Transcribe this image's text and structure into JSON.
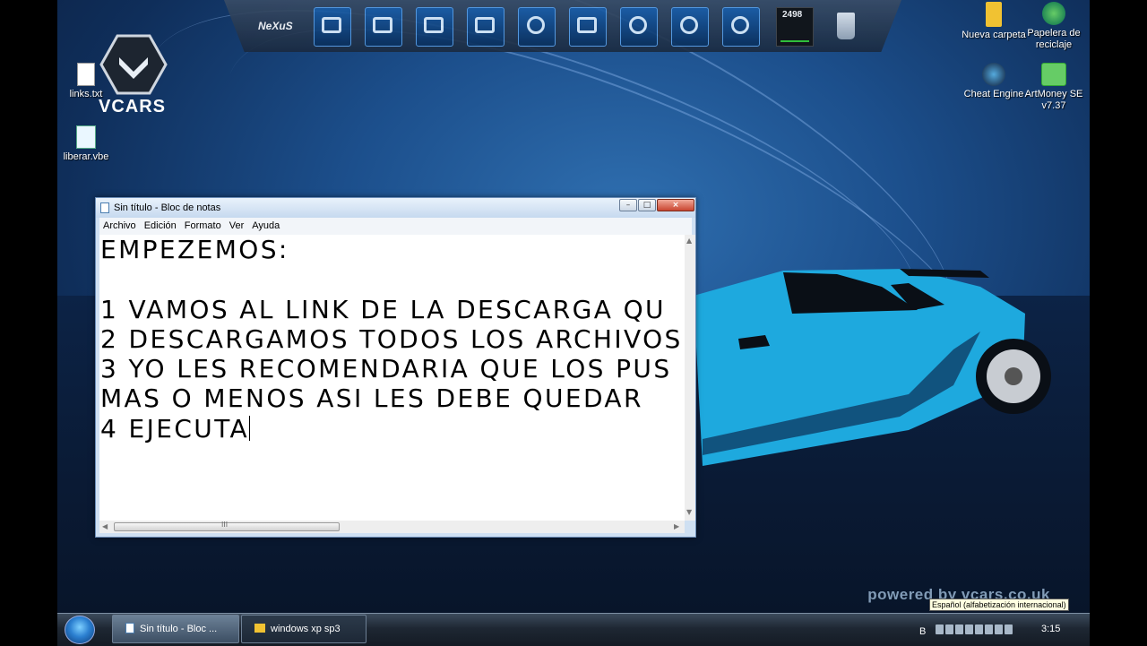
{
  "desktop": {
    "logo_text": "VCARS",
    "watermark": "powered by vcars.co.uk",
    "icons_left": [
      {
        "label": "links.txt",
        "icon": "text-file-icon"
      },
      {
        "label": "liberar.vbe",
        "icon": "script-file-icon"
      }
    ],
    "icons_right": [
      {
        "label": "Nueva carpeta",
        "icon": "folder-icon"
      },
      {
        "label": "Papelera de reciclaje",
        "icon": "recycle-bin-icon"
      },
      {
        "label": "Cheat Engine",
        "icon": "cheat-engine-icon"
      },
      {
        "label": "ArtMoney SE v7.37",
        "icon": "artmoney-icon"
      }
    ],
    "tooltip": "Español (alfabetización internacional)"
  },
  "dock": {
    "brand_label": "NeXuS",
    "cpu_readout": "2498",
    "items": [
      "nexus-logo-icon",
      "devices-icon",
      "monitor-icon",
      "folder-icon",
      "documents-icon",
      "vlc-icon",
      "camera-icon",
      "refresh-icon",
      "disc-icon",
      "sync-icon",
      "cpu-meter-icon",
      "trash-icon"
    ]
  },
  "notepad": {
    "title": "Sin título - Bloc de notas",
    "menu": [
      "Archivo",
      "Edición",
      "Formato",
      "Ver",
      "Ayuda"
    ],
    "lines": [
      "EMPEZEMOS:",
      "",
      "1 VAMOS AL LINK DE LA DESCARGA QU",
      "2 DESCARGAMOS TODOS LOS ARCHIVOS",
      "3 YO LES RECOMENDARIA QUE LOS PUS",
      "MAS O MENOS ASI LES DEBE QUEDAR",
      "4 EJECUTA"
    ],
    "hscroll_thumb_mark": "III"
  },
  "taskbar": {
    "tasks": [
      {
        "label": "Sin título - Bloc ...",
        "active": true
      },
      {
        "label": "windows xp sp3",
        "active": false
      }
    ],
    "tray_lang": "B",
    "clock": "3:15"
  },
  "colors": {
    "desktop_blue": "#1c4f8c",
    "car_cyan": "#1ea9de",
    "taskbar_dark": "#1e2733"
  }
}
